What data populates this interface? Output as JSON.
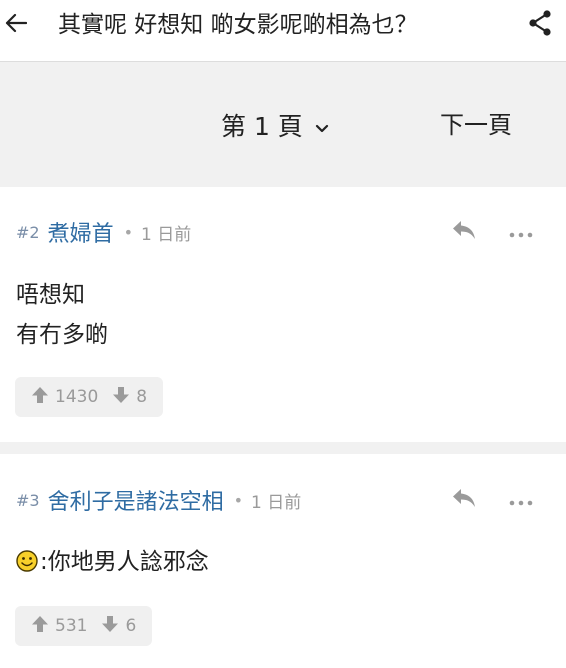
{
  "header": {
    "back_icon": "arrow-left-icon",
    "title": "其實呢 好想知 啲女影呢啲相為乜？",
    "share_icon": "share-icon"
  },
  "pager": {
    "page_label": "第 1 頁",
    "dropdown_icon": "chevron-down-icon",
    "next_label": "下一頁"
  },
  "posts": [
    {
      "floor": "#2",
      "author": "煮婦首",
      "dot": "•",
      "time": "1 日前",
      "content_lines": [
        "唔想知",
        "有冇多啲"
      ],
      "emoji": "",
      "upvotes": "1430",
      "downvotes": "8"
    },
    {
      "floor": "#3",
      "author": "舍利子是諸法空相",
      "dot": "•",
      "time": "1 日前",
      "content_lines": [
        ":你地男人諗邪念"
      ],
      "emoji": "smiley-face-icon",
      "upvotes": "531",
      "downvotes": "6"
    }
  ],
  "colors": {
    "author": "#2f6ca3",
    "floor": "#7a8ea8",
    "muted": "#9a9a9a",
    "background_band": "#f1f1f1"
  }
}
